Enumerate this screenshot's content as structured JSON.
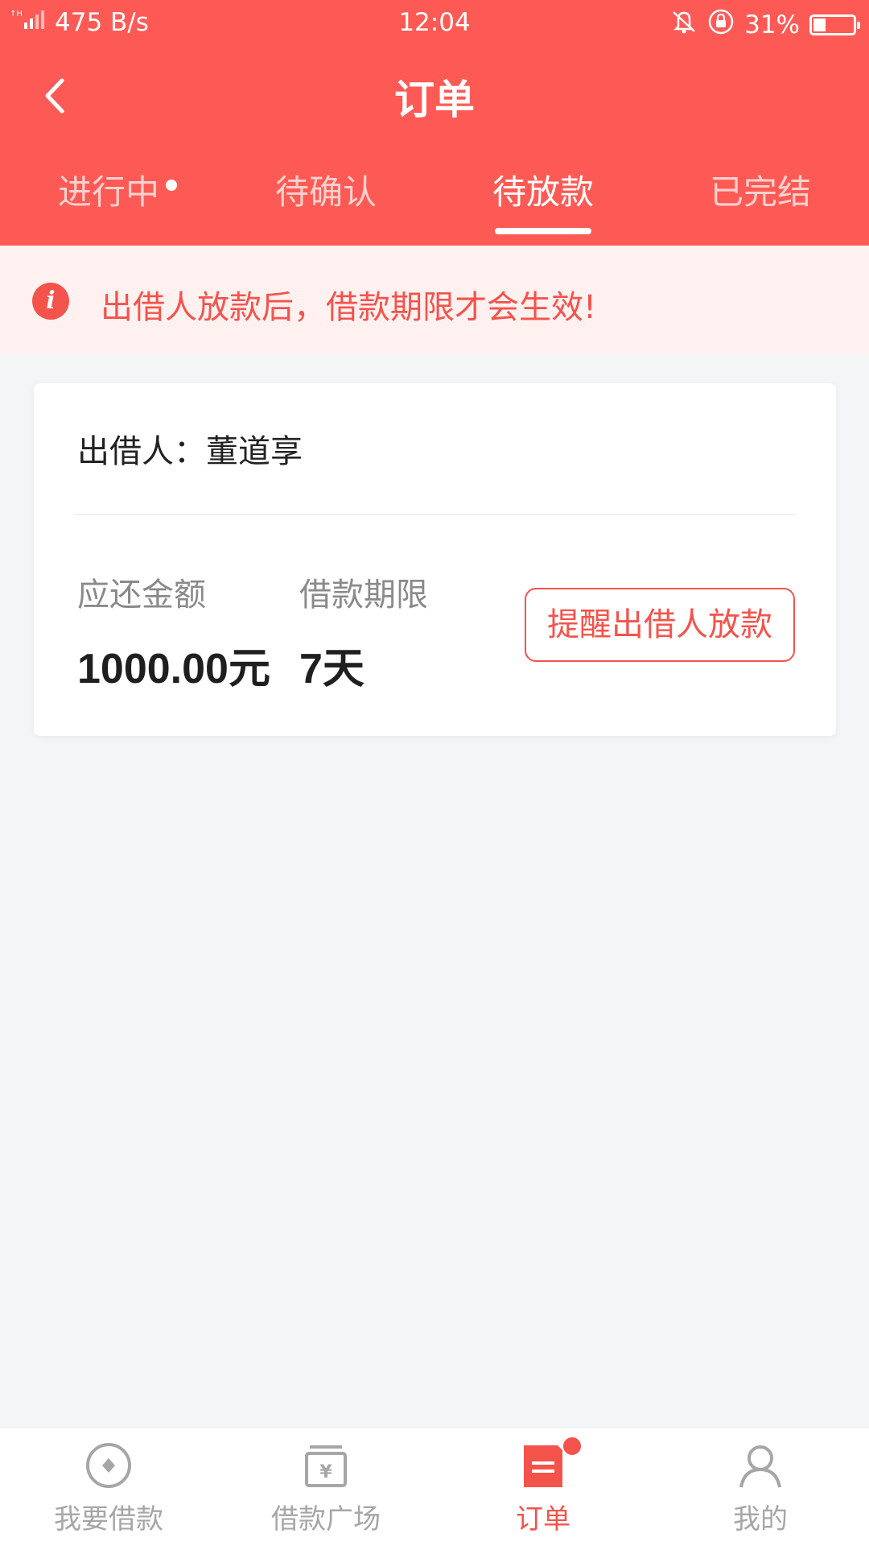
{
  "status_bar": {
    "network_speed": "475 B/s",
    "time": "12:04",
    "battery": "31%",
    "battery_level": 0.31
  },
  "nav": {
    "title": "订单"
  },
  "tabs": [
    {
      "label": "进行中",
      "has_dot": true,
      "active": false
    },
    {
      "label": "待确认",
      "has_dot": false,
      "active": false
    },
    {
      "label": "待放款",
      "has_dot": false,
      "active": true
    },
    {
      "label": "已完结",
      "has_dot": false,
      "active": false
    }
  ],
  "notice": {
    "icon": "i",
    "text": "出借人放款后，借款期限才会生效!"
  },
  "order": {
    "lender_label": "出借人：",
    "lender_name": "董道享",
    "amount_label": "应还金额",
    "amount_value": "1000.00元",
    "term_label": "借款期限",
    "term_value": "7天",
    "remind_button": "提醒出借人放款"
  },
  "bottom_nav": [
    {
      "label": "我要借款",
      "icon": "coin-icon",
      "active": false
    },
    {
      "label": "借款广场",
      "icon": "yen-box-icon",
      "active": false
    },
    {
      "label": "订单",
      "icon": "order-list-icon",
      "active": true,
      "badge": true
    },
    {
      "label": "我的",
      "icon": "user-icon",
      "active": false
    }
  ],
  "colors": {
    "header_red": "#fe5a55",
    "accent_red": "#f4534c",
    "notice_bg": "#fff1f0",
    "page_bg": "#f4f5f7"
  }
}
